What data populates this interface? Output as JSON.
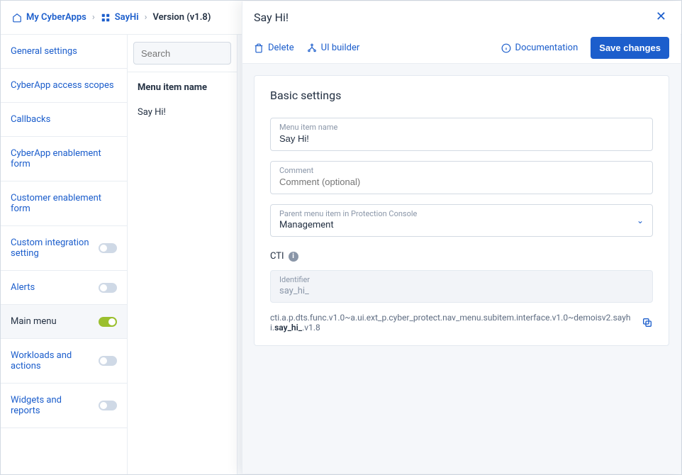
{
  "breadcrumb": {
    "root": "My CyberApps",
    "app": "SayHi",
    "version": "Version (v1.8)"
  },
  "sidebar": {
    "items": [
      {
        "label": "General settings",
        "toggle": null
      },
      {
        "label": "CyberApp access scopes",
        "toggle": null
      },
      {
        "label": "Callbacks",
        "toggle": null
      },
      {
        "label": "CyberApp enablement form",
        "toggle": null
      },
      {
        "label": "Customer enablement form",
        "toggle": null
      },
      {
        "label": "Custom integration setting",
        "toggle": false
      },
      {
        "label": "Alerts",
        "toggle": false
      },
      {
        "label": "Main menu",
        "toggle": true
      },
      {
        "label": "Workloads and actions",
        "toggle": false
      },
      {
        "label": "Widgets and reports",
        "toggle": false
      }
    ]
  },
  "midcol": {
    "search_placeholder": "Search",
    "header": "Menu item name",
    "items": [
      {
        "label": "Say Hi!"
      }
    ]
  },
  "panel": {
    "title": "Say Hi!",
    "delete": "Delete",
    "uibuilder": "UI builder",
    "documentation": "Documentation",
    "save": "Save changes",
    "card_title": "Basic settings",
    "fields": {
      "name_label": "Menu item name",
      "name_value": "Say Hi!",
      "comment_label": "Comment",
      "comment_placeholder": "Comment (optional)",
      "parent_label": "Parent menu item in Protection Console",
      "parent_value": "Management",
      "identifier_label": "Identifier",
      "identifier_value": "say_hi_"
    },
    "cti_label": "CTI",
    "cti_prefix": "cti.a.p.dts.func.v1.0~a.ui.ext_p.cyber_protect.nav_menu.subitem.interface.v1.0~demoisv2.sayhi.",
    "cti_bold": "say_hi_",
    "cti_suffix": ".v1.8"
  }
}
